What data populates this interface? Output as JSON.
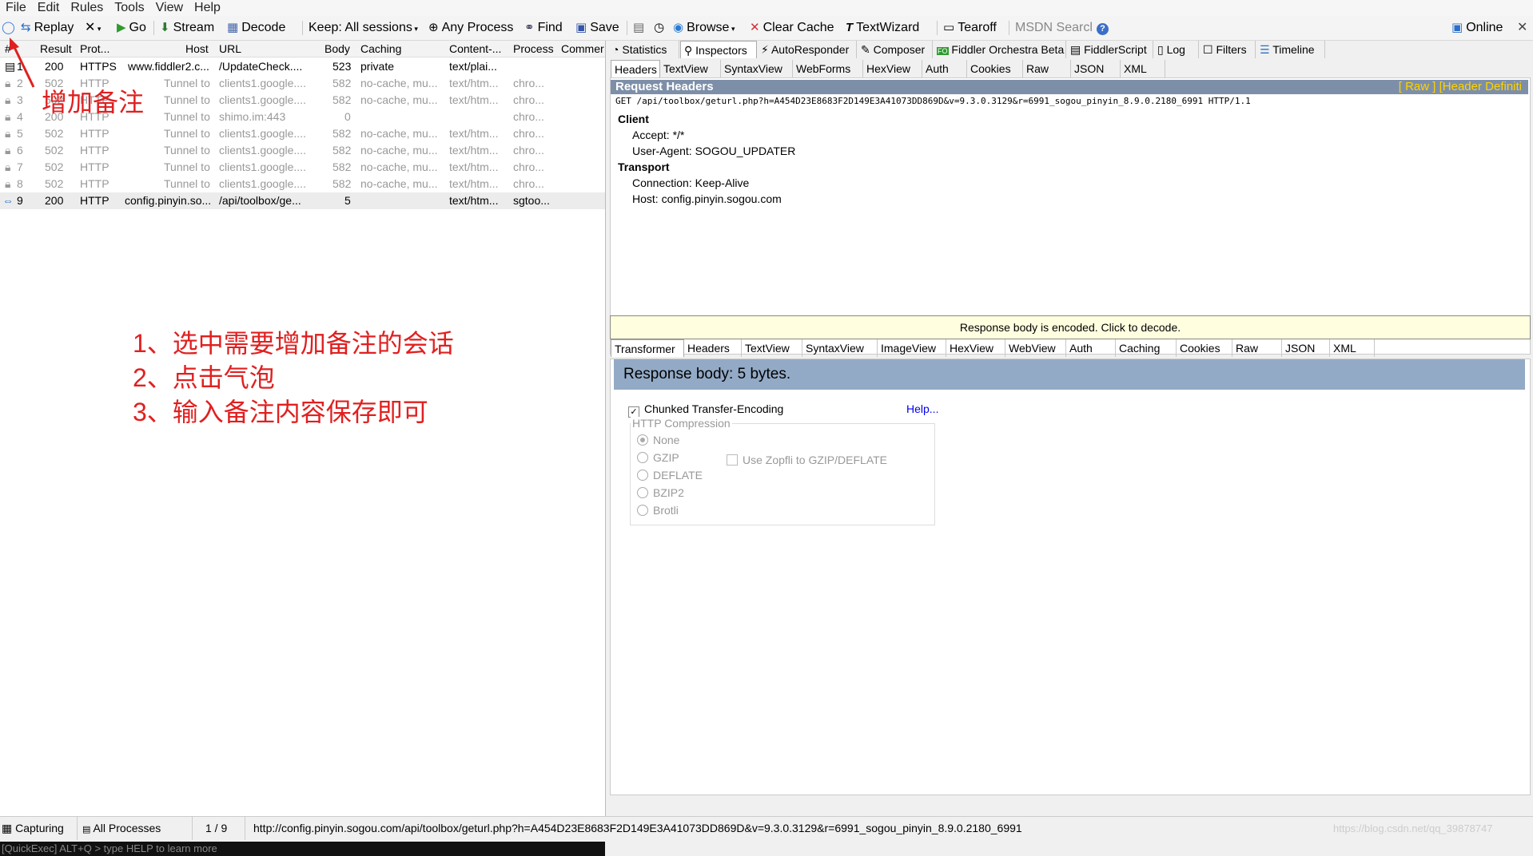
{
  "menu": [
    "File",
    "Edit",
    "Rules",
    "Tools",
    "View",
    "Help"
  ],
  "toolbar": {
    "replay": "Replay",
    "remove": "✕",
    "go": "Go",
    "stream": "Stream",
    "decode": "Decode",
    "keep": "Keep: All sessions",
    "any_process": "Any Process",
    "find": "Find",
    "save": "Save",
    "browse": "Browse",
    "clear_cache": "Clear Cache",
    "textwizard": "TextWizard",
    "tearoff": "Tearoff",
    "msdn_search": "MSDN Searcl",
    "online": "Online"
  },
  "columns": [
    "#",
    "Result",
    "Prot...",
    "Host",
    "URL",
    "Body",
    "Caching",
    "Content-...",
    "Process",
    "Commer"
  ],
  "sessions": [
    {
      "num": "1",
      "result": "200",
      "protocol": "HTTPS",
      "host": "www.fiddler2.c...",
      "url": "/UpdateCheck....",
      "body": "523",
      "caching": "private",
      "content": "text/plai...",
      "process": ""
    },
    {
      "num": "2",
      "result": "502",
      "protocol": "HTTP",
      "host": "Tunnel to",
      "url": "clients1.google....",
      "body": "582",
      "caching": "no-cache, mu...",
      "content": "text/htm...",
      "process": "chro..."
    },
    {
      "num": "3",
      "result": "502",
      "protocol": "HTTP",
      "host": "Tunnel to",
      "url": "clients1.google....",
      "body": "582",
      "caching": "no-cache, mu...",
      "content": "text/htm...",
      "process": "chro..."
    },
    {
      "num": "4",
      "result": "200",
      "protocol": "HTTP",
      "host": "Tunnel to",
      "url": "shimo.im:443",
      "body": "0",
      "caching": "",
      "content": "",
      "process": "chro..."
    },
    {
      "num": "5",
      "result": "502",
      "protocol": "HTTP",
      "host": "Tunnel to",
      "url": "clients1.google....",
      "body": "582",
      "caching": "no-cache, mu...",
      "content": "text/htm...",
      "process": "chro..."
    },
    {
      "num": "6",
      "result": "502",
      "protocol": "HTTP",
      "host": "Tunnel to",
      "url": "clients1.google....",
      "body": "582",
      "caching": "no-cache, mu...",
      "content": "text/htm...",
      "process": "chro..."
    },
    {
      "num": "7",
      "result": "502",
      "protocol": "HTTP",
      "host": "Tunnel to",
      "url": "clients1.google....",
      "body": "582",
      "caching": "no-cache, mu...",
      "content": "text/htm...",
      "process": "chro..."
    },
    {
      "num": "8",
      "result": "502",
      "protocol": "HTTP",
      "host": "Tunnel to",
      "url": "clients1.google....",
      "body": "582",
      "caching": "no-cache, mu...",
      "content": "text/htm...",
      "process": "chro..."
    },
    {
      "num": "9",
      "result": "200",
      "protocol": "HTTP",
      "host": "config.pinyin.so...",
      "url": "/api/toolbox/ge...",
      "body": "5",
      "caching": "",
      "content": "text/htm...",
      "process": "sgtoo..."
    }
  ],
  "annotation": {
    "label": "增加备注",
    "step1": "1、选中需要增加备注的会话",
    "step2": "2、点击气泡",
    "step3": "3、输入备注内容保存即可"
  },
  "quickexec": "[QuickExec] ALT+Q > type HELP to learn more",
  "main_tabs": [
    "Statistics",
    "Inspectors",
    "AutoResponder",
    "Composer",
    "Fiddler Orchestra Beta",
    "FiddlerScript",
    "Log",
    "Filters",
    "Timeline"
  ],
  "request_tabs": [
    "Headers",
    "TextView",
    "SyntaxView",
    "WebForms",
    "HexView",
    "Auth",
    "Cookies",
    "Raw",
    "JSON",
    "XML"
  ],
  "request": {
    "title": "Request Headers",
    "links": "[ Raw ]  [Header Definiti",
    "request_line": "GET /api/toolbox/geturl.php?h=A454D23E8683F2D149E3A41073DD869D&v=9.3.0.3129&r=6991_sogou_pinyin_8.9.0.2180_6991 HTTP/1.1",
    "client_label": "Client",
    "accept": "Accept: */*",
    "user_agent": "User-Agent: SOGOU_UPDATER",
    "transport_label": "Transport",
    "connection": "Connection: Keep-Alive",
    "host": "Host: config.pinyin.sogou.com"
  },
  "response_notice": "Response body is encoded. Click to decode.",
  "response_tabs": [
    "Transformer",
    "Headers",
    "TextView",
    "SyntaxView",
    "ImageView",
    "HexView",
    "WebView",
    "Auth",
    "Caching",
    "Cookies",
    "Raw",
    "JSON",
    "XML"
  ],
  "response": {
    "title": "Response body: 5 bytes.",
    "chunked": "Chunked Transfer-Encoding",
    "help": "Help...",
    "compression_label": "HTTP Compression",
    "options": [
      "None",
      "GZIP",
      "DEFLATE",
      "BZIP2",
      "Brotli"
    ],
    "zopfli": "Use Zopfli to GZIP/DEFLATE"
  },
  "status": {
    "capturing": "Capturing",
    "processes": "All Processes",
    "count": "1 / 9",
    "url": "http://config.pinyin.sogou.com/api/toolbox/geturl.php?h=A454D23E8683F2D149E3A41073DD869D&v=9.3.0.3129&r=6991_sogou_pinyin_8.9.0.2180_6991",
    "watermark": "https://blog.csdn.net/qq_39878747"
  }
}
